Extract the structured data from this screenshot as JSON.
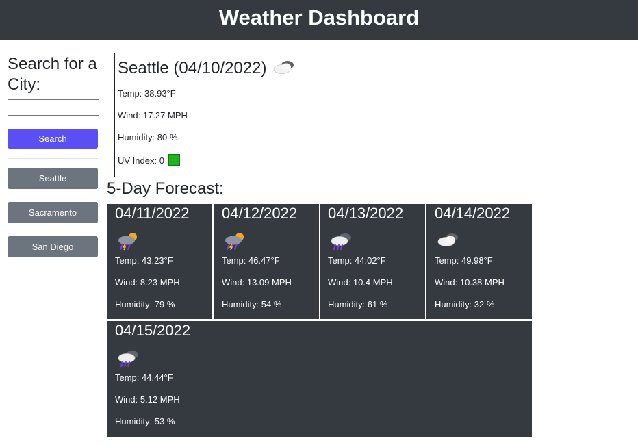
{
  "header": {
    "title": "Weather Dashboard"
  },
  "search": {
    "heading": "Search for a City:",
    "input_value": "",
    "button_label": "Search"
  },
  "history": [
    "Seattle",
    "Sacramento",
    "San Diego"
  ],
  "current": {
    "title": "Seattle (04/10/2022)",
    "icon": "broken-clouds-icon",
    "temp": "Temp: 38.93°F",
    "wind": "Wind: 17.27 MPH",
    "humidity": "Humidity: 80 %",
    "uv": "UV Index: 0",
    "uv_color": "#1fb21f"
  },
  "forecast": {
    "title": "5-Day Forecast:",
    "days": [
      {
        "date": "04/11/2022",
        "icon": "thunder-rain-sun-icon",
        "temp": "Temp: 43.23°F",
        "wind": "Wind: 8.23 MPH",
        "humidity": "Humidity: 79 %"
      },
      {
        "date": "04/12/2022",
        "icon": "thunder-rain-sun-icon",
        "temp": "Temp: 46.47°F",
        "wind": "Wind: 13.09 MPH",
        "humidity": "Humidity: 54 %"
      },
      {
        "date": "04/13/2022",
        "icon": "rain-cloud-icon",
        "temp": "Temp: 44.02°F",
        "wind": "Wind: 10.4 MPH",
        "humidity": "Humidity: 61 %"
      },
      {
        "date": "04/14/2022",
        "icon": "broken-clouds-icon",
        "temp": "Temp: 49.98°F",
        "wind": "Wind: 10.38 MPH",
        "humidity": "Humidity: 32 %"
      },
      {
        "date": "04/15/2022",
        "icon": "rain-cloud-icon",
        "temp": "Temp: 44.44°F",
        "wind": "Wind: 5.12 MPH",
        "humidity": "Humidity: 53 %"
      }
    ]
  },
  "colors": {
    "header_bg": "#343a40",
    "search_button": "#5a4ff5",
    "history_button": "#6c757d",
    "card_bg": "#343a40"
  }
}
